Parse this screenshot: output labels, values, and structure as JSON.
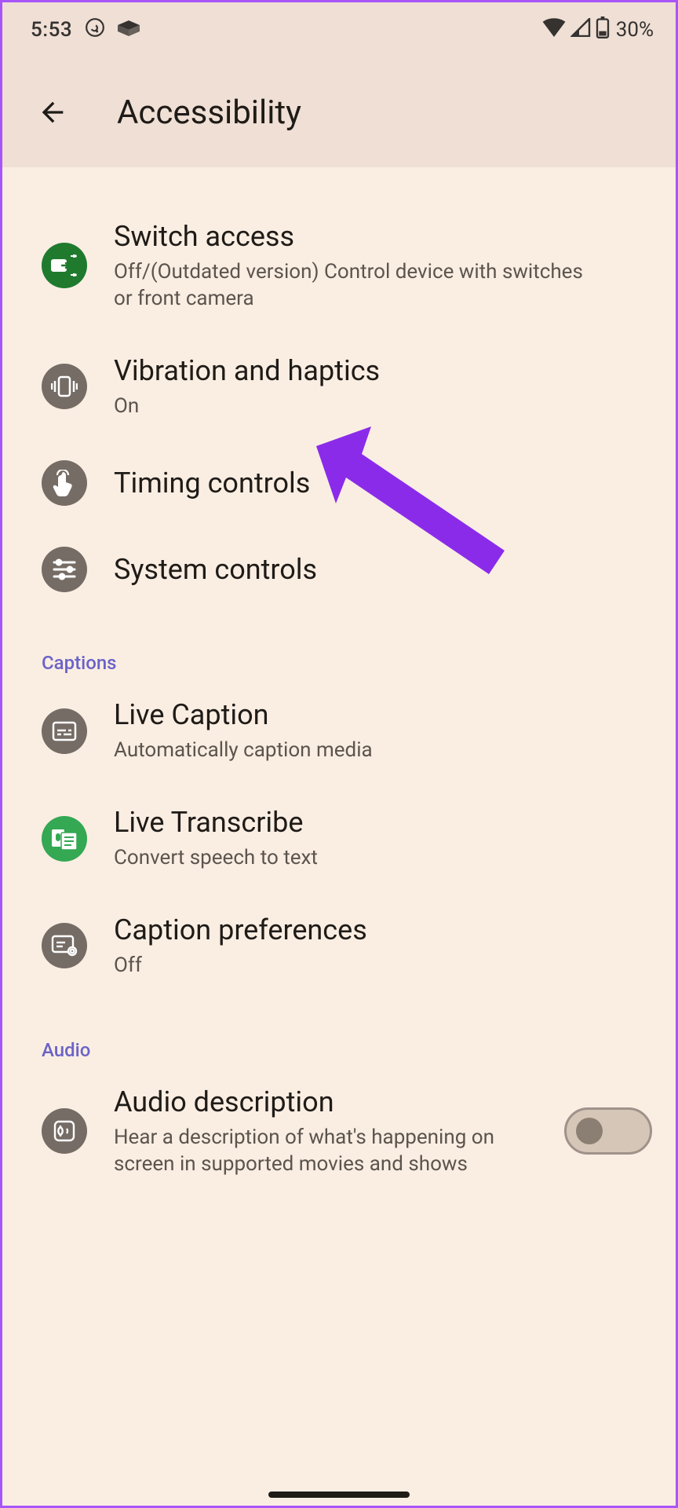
{
  "status": {
    "time": "5:53",
    "battery": "30%"
  },
  "header": {
    "title": "Accessibility"
  },
  "items": {
    "switch_access": {
      "title": "Switch access",
      "sub": "Off/(Outdated version) Control device with switches or front camera"
    },
    "vibration": {
      "title": "Vibration and haptics",
      "sub": "On"
    },
    "timing": {
      "title": "Timing controls"
    },
    "system": {
      "title": "System controls"
    },
    "live_caption": {
      "title": "Live Caption",
      "sub": "Automatically caption media"
    },
    "live_transcribe": {
      "title": "Live Transcribe",
      "sub": "Convert speech to text"
    },
    "caption_prefs": {
      "title": "Caption preferences",
      "sub": "Off"
    },
    "audio_desc": {
      "title": "Audio description",
      "sub": "Hear a description of what's happening on screen in supported movies and shows"
    }
  },
  "sections": {
    "captions": "Captions",
    "audio": "Audio"
  },
  "toggles": {
    "audio_desc": false
  },
  "colors": {
    "accent_arrow": "#8b2bea",
    "section_label": "#6b63c7",
    "bg": "#faeee3",
    "header_bg": "#efdfd5"
  }
}
